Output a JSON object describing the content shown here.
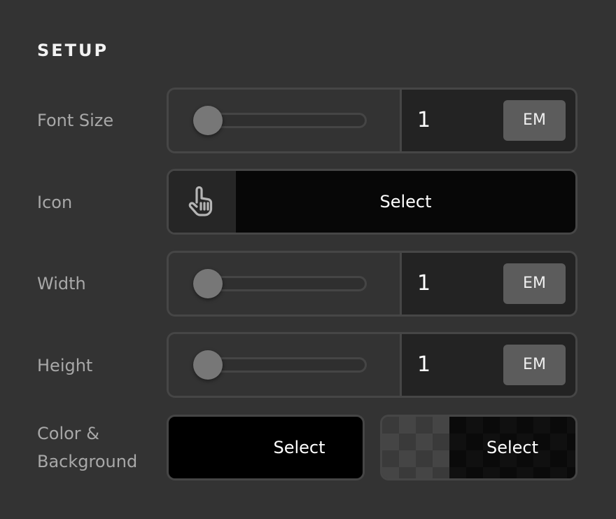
{
  "section": {
    "title": "SETUP"
  },
  "rows": {
    "font_size": {
      "label": "Font Size",
      "slider_fraction": 0.0,
      "value": "1",
      "unit": "EM"
    },
    "icon": {
      "label": "Icon",
      "icon_name": "hand-pointer-icon",
      "select_label": "Select"
    },
    "width": {
      "label": "Width",
      "slider_fraction": 0.0,
      "value": "1",
      "unit": "EM"
    },
    "height": {
      "label": "Height",
      "slider_fraction": 0.0,
      "value": "1",
      "unit": "EM"
    },
    "color_background": {
      "label_line1": "Color &",
      "label_line2": "Background",
      "color_select_label": "Select",
      "background_select_label": "Select",
      "color_value": "#000000",
      "background_value": "transparent"
    }
  }
}
